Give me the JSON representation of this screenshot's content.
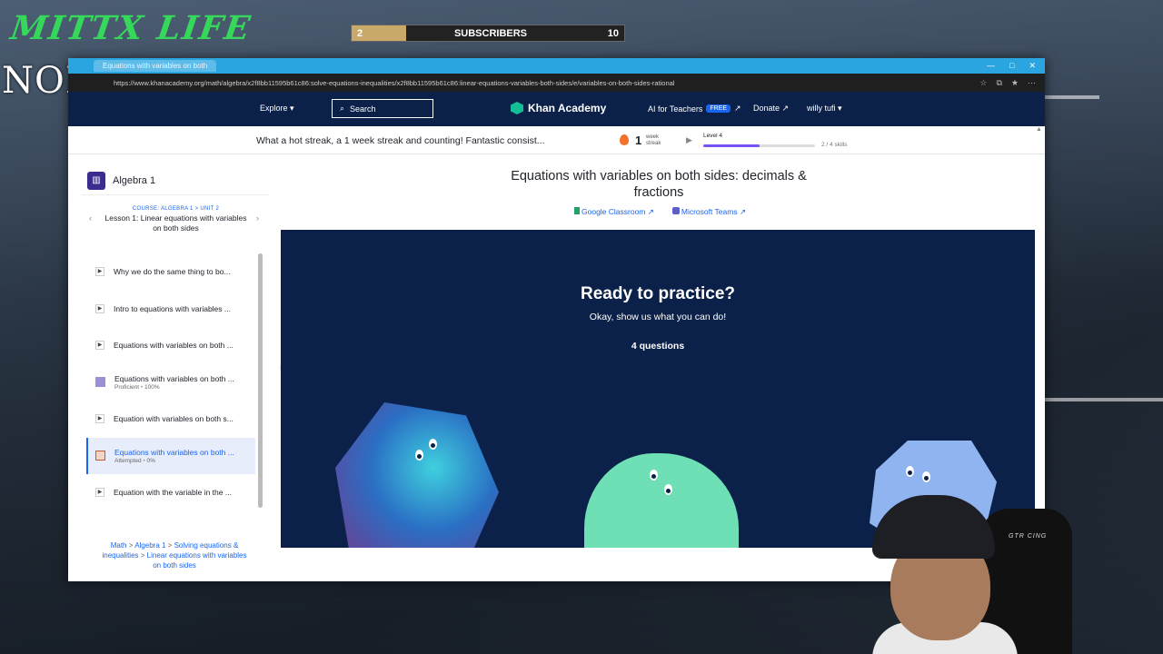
{
  "overlay": {
    "handwritten_text": "MITTX LIFE",
    "brand_text": "NODESTOP.IO",
    "subscribers": {
      "left_count": "2",
      "label": "SUBSCRIBERS",
      "right_count": "10",
      "progress": 0.2
    }
  },
  "browser": {
    "tab_title": "Equations with variables on both",
    "url": "https://www.khanacademy.org/math/algebra/x2f8bb11595b61c86:solve-equations-inequalities/x2f8bb11595b61c86:linear-equations-variables-both-sides/e/variables-on-both-sides-rational"
  },
  "nav": {
    "explore": "Explore",
    "search": "Search",
    "logo": "Khan Academy",
    "teachers": "AI for Teachers",
    "free_badge": "FREE",
    "donate": "Donate",
    "user": "willy tufi"
  },
  "streak": {
    "message": "What a hot streak, a 1 week streak and counting! Fantastic consist...",
    "count": "1",
    "unit_line1": "week",
    "unit_line2": "streak",
    "level": "Level 4",
    "level_progress": 0.5,
    "skills": "2 / 4 skills"
  },
  "sidebar": {
    "course_title": "Algebra 1",
    "course_kicker": "COURSE: ALGEBRA 1 > UNIT 2",
    "lesson_title": "Lesson 1: Linear equations with variables on both sides",
    "items": [
      {
        "label": "Why we do the same thing to bo...",
        "type": "video"
      },
      {
        "label": "Intro to equations with variables ...",
        "type": "video"
      },
      {
        "label": "Equations with variables on both ...",
        "type": "video"
      },
      {
        "label": "Equations with variables on both ...",
        "type": "exercise",
        "status": "Proficient",
        "score": "100%"
      },
      {
        "label": "Equation with variables on both s...",
        "type": "video"
      },
      {
        "label": "Equations with variables on both ...",
        "type": "exercise",
        "status": "Attempted",
        "score": "0%"
      },
      {
        "label": "Equation with the variable in the ...",
        "type": "video"
      }
    ],
    "breadcrumb": {
      "math": "Math",
      "sep": ">",
      "algebra": "Algebra 1",
      "unit": "Solving equations & inequalities",
      "lesson": "Linear equations with variables on both sides"
    }
  },
  "main": {
    "title": "Equations with variables on both sides: decimals & fractions",
    "google_classroom": "Google Classroom",
    "microsoft_teams": "Microsoft Teams",
    "ready_title": "Ready to practice?",
    "ready_sub": "Okay, show us what you can do!",
    "question_count": "4 questions"
  },
  "webcam": {
    "chair_text": "GTR CING"
  }
}
